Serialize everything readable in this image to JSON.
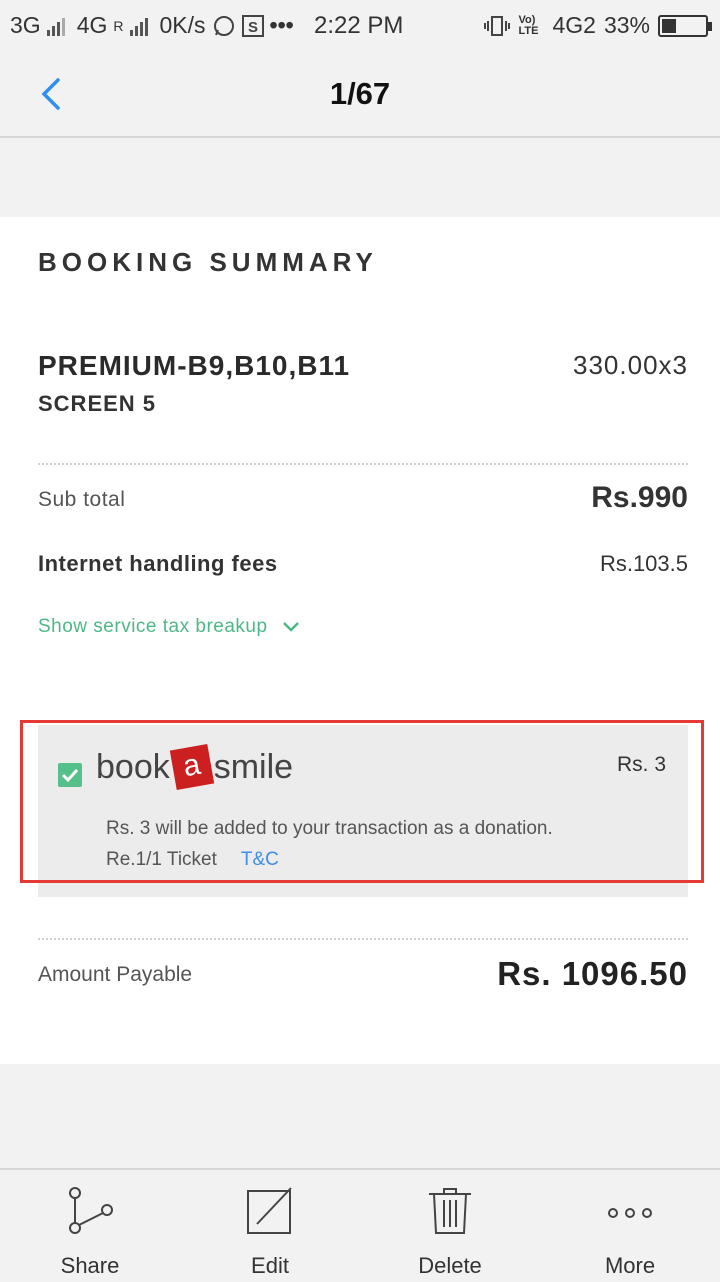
{
  "status_bar": {
    "network1": "3G",
    "network2": "4G",
    "roaming": "R",
    "speed": "0K/s",
    "time": "2:22 PM",
    "volte": "Vo) LTE",
    "network3": "4G2",
    "battery_percent": "33%",
    "battery_level": 0.33
  },
  "header": {
    "back_icon": "chevron-left-icon",
    "title": "1/67"
  },
  "summary": {
    "heading": "BOOKING SUMMARY",
    "ticket_type": "PREMIUM-B9,B10,B11",
    "ticket_price": "330.00x3",
    "screen": "SCREEN 5",
    "subtotal_label": "Sub total",
    "subtotal_value": "Rs.990",
    "fees_label": "Internet handling fees",
    "fees_value": "Rs.103.5",
    "tax_link": "Show service tax breakup",
    "donation": {
      "checked": true,
      "logo_pre": "book",
      "logo_badge": "a",
      "logo_post": "smile",
      "amount": "Rs. 3",
      "text": "Rs. 3 will be added to your transaction as a donation.",
      "ticket_rate": "Re.1/1 Ticket",
      "tnc": "T&C"
    },
    "amount_label": "Amount Payable",
    "amount_value": "Rs. 1096.50"
  },
  "bottom_bar": {
    "share": "Share",
    "edit": "Edit",
    "delete": "Delete",
    "more": "More"
  },
  "colors": {
    "accent_green": "#56c08a",
    "link_blue": "#3e8ee8",
    "highlight_red": "#e53935",
    "back_blue": "#2f8ff0"
  }
}
